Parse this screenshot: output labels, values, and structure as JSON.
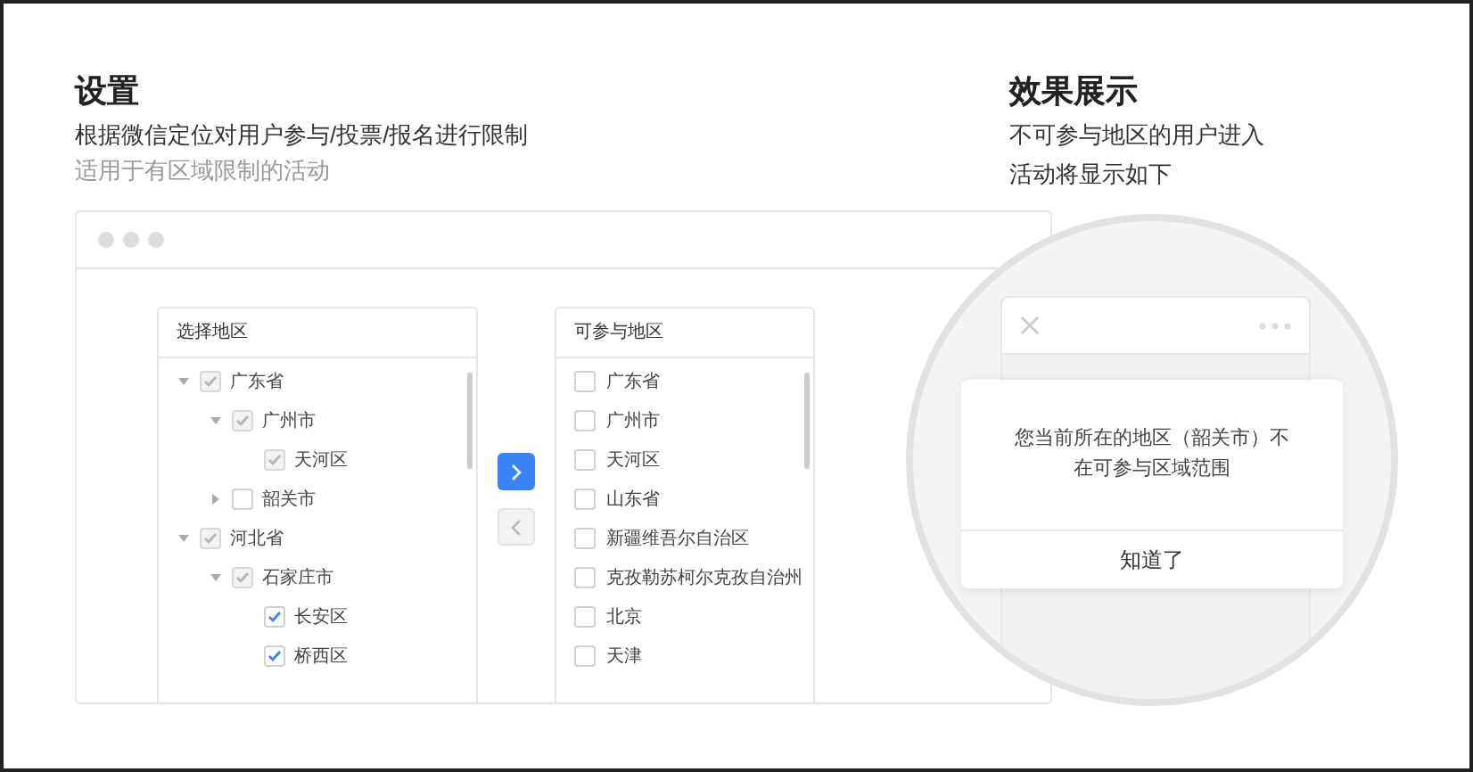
{
  "settings": {
    "title": "设置",
    "description": "根据微信定位对用户参与/投票/报名进行限制",
    "note": "适用于有区域限制的活动"
  },
  "preview": {
    "title": "效果展示",
    "lines": [
      "不可参与地区的用户进入",
      "活动将显示如下"
    ]
  },
  "source_panel": {
    "title": "选择地区",
    "tree": [
      {
        "label": "广东省",
        "checked": true,
        "disabled": true,
        "expanded": true,
        "children": [
          {
            "label": "广州市",
            "checked": true,
            "disabled": true,
            "expanded": true,
            "children": [
              {
                "label": "天河区",
                "checked": true,
                "disabled": true
              }
            ]
          },
          {
            "label": "韶关市",
            "checked": false,
            "disabled": false,
            "expanded": false
          }
        ]
      },
      {
        "label": "河北省",
        "checked": true,
        "disabled": true,
        "expanded": true,
        "children": [
          {
            "label": "石家庄市",
            "checked": true,
            "disabled": true,
            "expanded": true,
            "children": [
              {
                "label": "长安区",
                "checked": true,
                "disabled": false
              },
              {
                "label": "桥西区",
                "checked": true,
                "disabled": false
              }
            ]
          }
        ]
      }
    ]
  },
  "transfer_buttons": [
    {
      "kind": "forward",
      "disabled": false
    },
    {
      "kind": "back",
      "disabled": true
    }
  ],
  "target_panel": {
    "title": "可参与地区",
    "items": [
      {
        "label": "广东省",
        "checked": false
      },
      {
        "label": "广州市",
        "checked": false
      },
      {
        "label": "天河区",
        "checked": false
      },
      {
        "label": "山东省",
        "checked": false
      },
      {
        "label": "新疆维吾尔自治区",
        "checked": false
      },
      {
        "label": "克孜勒苏柯尔克孜自治州",
        "checked": false
      },
      {
        "label": "北京",
        "checked": false
      },
      {
        "label": "天津",
        "checked": false
      }
    ]
  },
  "dialog": {
    "message": "您当前所在的地区（韶关市）不在可参与区域范围",
    "button": "知道了"
  }
}
